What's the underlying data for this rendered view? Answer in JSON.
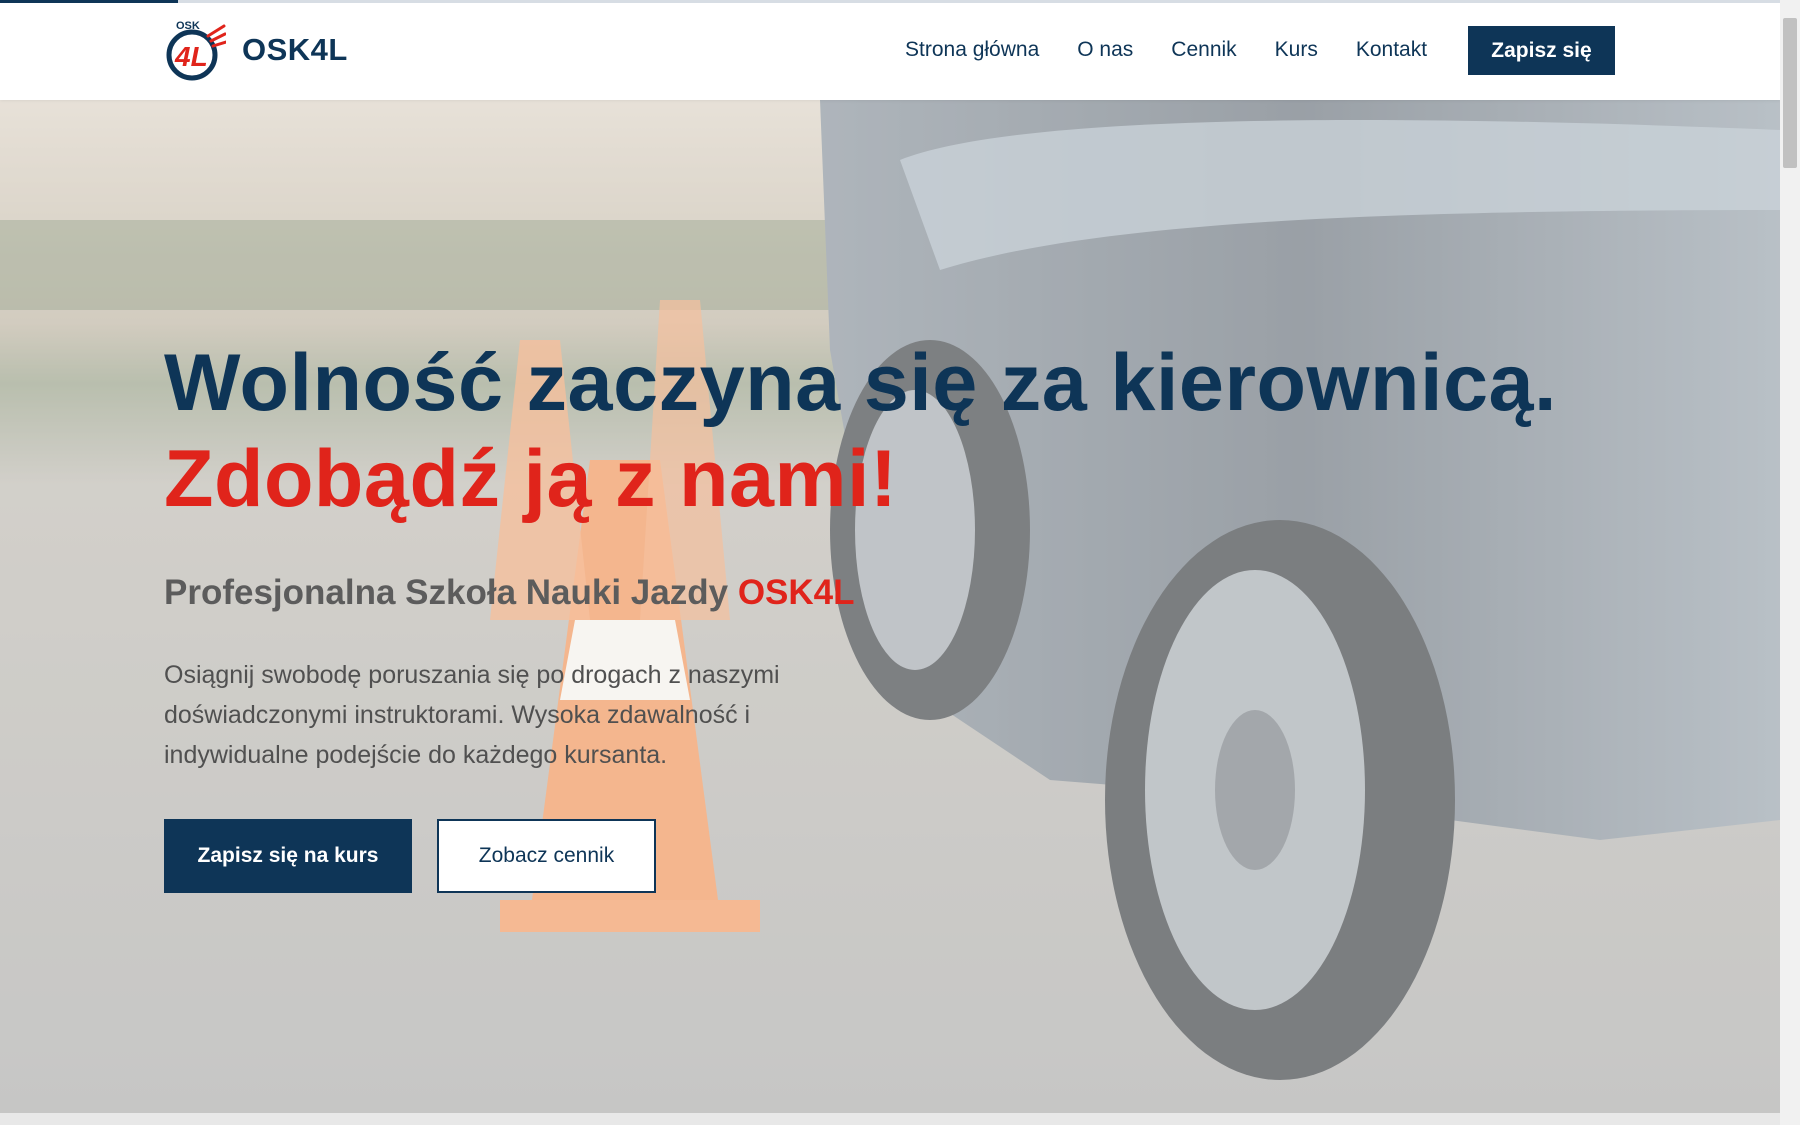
{
  "page": {
    "scroll_progress": 0.1
  },
  "header": {
    "logo": {
      "mark_top": "OSK",
      "mark_main": "4L",
      "brand": "OSK4L"
    },
    "nav": [
      {
        "label": "Strona główna"
      },
      {
        "label": "O nas"
      },
      {
        "label": "Cennik"
      },
      {
        "label": "Kurs"
      },
      {
        "label": "Kontakt"
      }
    ],
    "cta_label": "Zapisz się"
  },
  "hero": {
    "title_line1": "Wolność zaczyna się za kierownicą.",
    "title_line2": "Zdobądź ją z nami!",
    "subtitle_prefix": "Profesjonalna Szkoła Nauki Jazdy",
    "subtitle_accent": "OSK4L",
    "description": "Osiągnij swobodę poruszania się po drogach z naszymi doświadczonymi instruktorami. Wysoka zdawalność i indywidualne podejście do każdego kursanta.",
    "primary_button": "Zapisz się na kurs",
    "secondary_button": "Zobacz cennik"
  },
  "colors": {
    "navy": "#0e3557",
    "red": "#e0241b",
    "white": "#ffffff"
  }
}
